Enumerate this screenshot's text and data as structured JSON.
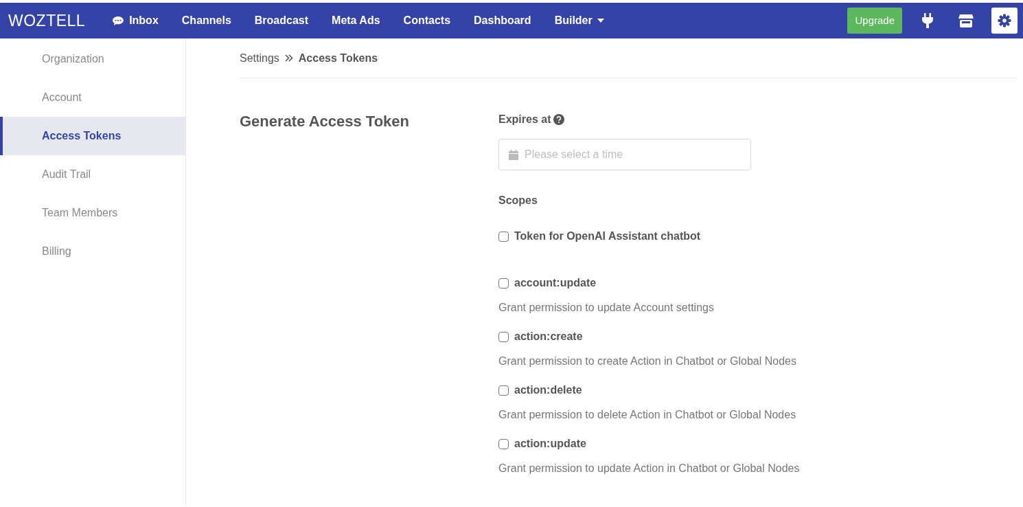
{
  "navbar": {
    "logo": "WOZTELL",
    "items": [
      {
        "label": "Inbox",
        "dropdown": false
      },
      {
        "label": "Channels",
        "dropdown": false
      },
      {
        "label": "Broadcast",
        "dropdown": false
      },
      {
        "label": "Meta Ads",
        "dropdown": false
      },
      {
        "label": "Contacts",
        "dropdown": false
      },
      {
        "label": "Dashboard",
        "dropdown": false
      },
      {
        "label": "Builder",
        "dropdown": true
      }
    ],
    "upgrade": "Upgrade",
    "icon_buttons": [
      {
        "kind": "plug",
        "selected": false
      },
      {
        "kind": "store",
        "selected": false
      },
      {
        "kind": "settings",
        "selected": true
      }
    ]
  },
  "sidebar": {
    "items": [
      {
        "label": "Organization",
        "selected": false
      },
      {
        "label": "Account",
        "selected": false
      },
      {
        "label": "Access Tokens",
        "selected": true
      },
      {
        "label": "Audit Trail",
        "selected": false
      },
      {
        "label": "Team Members",
        "selected": false
      },
      {
        "label": "Billing",
        "selected": false
      }
    ]
  },
  "breadcrumb": [
    "Settings",
    "Access Tokens"
  ],
  "section_title": "Generate Access Token",
  "expires": {
    "label": "Expires at",
    "placeholder": "Please select a time"
  },
  "scopes": {
    "label": "Scopes",
    "items": [
      {
        "label": "Token for OpenAI Assistant chatbot",
        "checked": false
      },
      {
        "label": "account:update",
        "description": "Grant permission to update Account settings",
        "checked": false
      },
      {
        "label": "action:create",
        "description": "Grant permission to create Action in Chatbot or Global Nodes",
        "checked": false
      },
      {
        "label": "action:delete",
        "description": "Grant permission to delete Action in Chatbot or Global Nodes",
        "checked": false
      },
      {
        "label": "action:update",
        "description": "Grant permission to update Action in Chatbot or Global Nodes",
        "checked": false
      }
    ]
  }
}
